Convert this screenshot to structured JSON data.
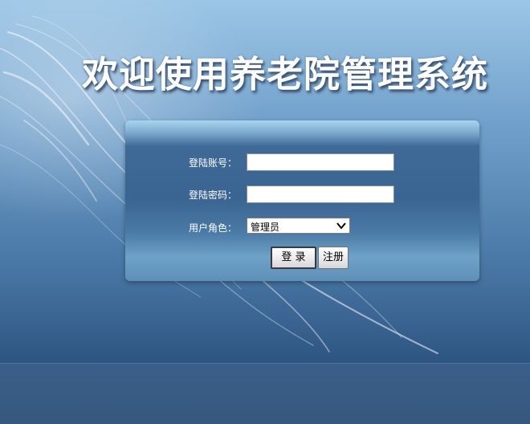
{
  "title": "欢迎使用养老院管理系统",
  "form": {
    "account_label": "登陆账号：",
    "account_value": "",
    "password_label": "登陆密码：",
    "password_value": "",
    "role_label": "用户角色：",
    "role_selected": "管理员",
    "login_label": "登 录",
    "register_label": "注册"
  },
  "colors": {
    "background_top": "#9cc6e6",
    "background_bottom": "#27486f",
    "panel": "#3a6491",
    "label_text": "#ffffff"
  },
  "icons": {
    "select_arrow": "chevron-down-icon"
  }
}
